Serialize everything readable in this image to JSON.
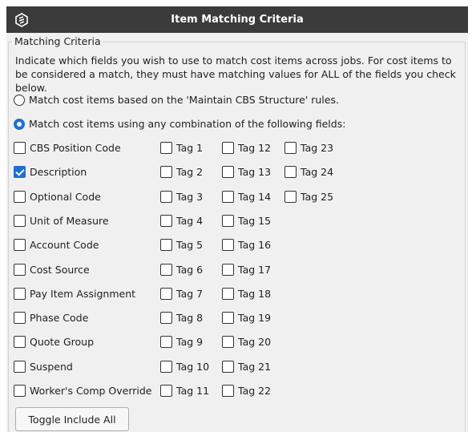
{
  "dialog": {
    "title": "Item Matching Criteria",
    "logo_icon": "company-logo-icon"
  },
  "group": {
    "label": "Matching Criteria",
    "instructions": "Indicate which fields you wish to use to match cost items across jobs. For cost items to be considered a match, they must have matching values for ALL of the fields you check below."
  },
  "radios": [
    {
      "label": "Match cost items based on the 'Maintain CBS Structure' rules.",
      "checked": false
    },
    {
      "label": "Match cost items using any combination of the following fields:",
      "checked": true
    }
  ],
  "fields": [
    {
      "label": "CBS Position Code",
      "checked": false
    },
    {
      "label": "Description",
      "checked": true
    },
    {
      "label": "Optional Code",
      "checked": false
    },
    {
      "label": "Unit of Measure",
      "checked": false
    },
    {
      "label": "Account Code",
      "checked": false
    },
    {
      "label": "Cost Source",
      "checked": false
    },
    {
      "label": "Pay Item Assignment",
      "checked": false
    },
    {
      "label": "Phase Code",
      "checked": false
    },
    {
      "label": "Quote Group",
      "checked": false
    },
    {
      "label": "Suspend",
      "checked": false
    },
    {
      "label": "Worker's Comp Override",
      "checked": false
    }
  ],
  "tags_col1": [
    "Tag 1",
    "Tag 2",
    "Tag 3",
    "Tag 4",
    "Tag 5",
    "Tag 6",
    "Tag 7",
    "Tag 8",
    "Tag 9",
    "Tag 10",
    "Tag 11"
  ],
  "tags_col2": [
    "Tag 12",
    "Tag 13",
    "Tag 14",
    "Tag 15",
    "Tag 16",
    "Tag 17",
    "Tag 18",
    "Tag 19",
    "Tag 20",
    "Tag 21",
    "Tag 22"
  ],
  "tags_col3": [
    "Tag 23",
    "Tag 24",
    "Tag 25"
  ],
  "toggle_button": "Toggle Include All",
  "colors": {
    "title_bar": "#3b3b3b",
    "accent": "#1f6fd1",
    "panel": "#f0f0f0"
  }
}
